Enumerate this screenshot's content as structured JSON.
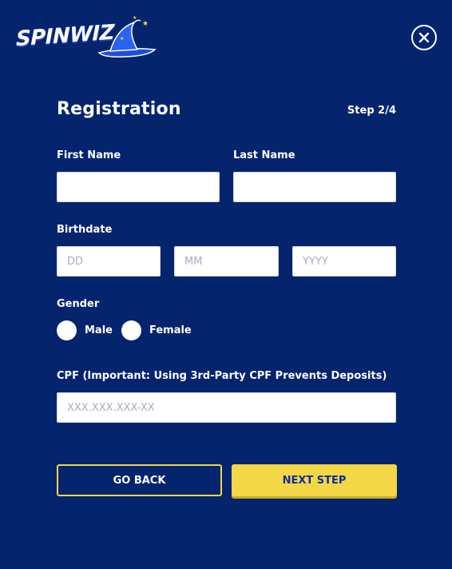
{
  "brand": {
    "logo_text": "SPINWIZ"
  },
  "header": {
    "close_label": "×"
  },
  "form": {
    "title": "Registration",
    "step": "Step 2/4",
    "first_name": {
      "label": "First Name",
      "value": "",
      "placeholder": ""
    },
    "last_name": {
      "label": "Last Name",
      "value": "",
      "placeholder": ""
    },
    "birthdate": {
      "label": "Birthdate",
      "day_placeholder": "DD",
      "month_placeholder": "MM",
      "year_placeholder": "YYYY"
    },
    "gender": {
      "label": "Gender",
      "options": [
        "Male",
        "Female"
      ]
    },
    "cpf": {
      "label": "CPF (Important: Using 3rd-Party CPF Prevents Deposits)",
      "placeholder": "XXX.XXX.XXX-XX"
    },
    "buttons": {
      "back": "GO BACK",
      "next": "NEXT STEP"
    }
  },
  "colors": {
    "background": "#04246e",
    "accent": "#f3d746",
    "input_bg": "#ffffff",
    "text": "#ffffff"
  }
}
